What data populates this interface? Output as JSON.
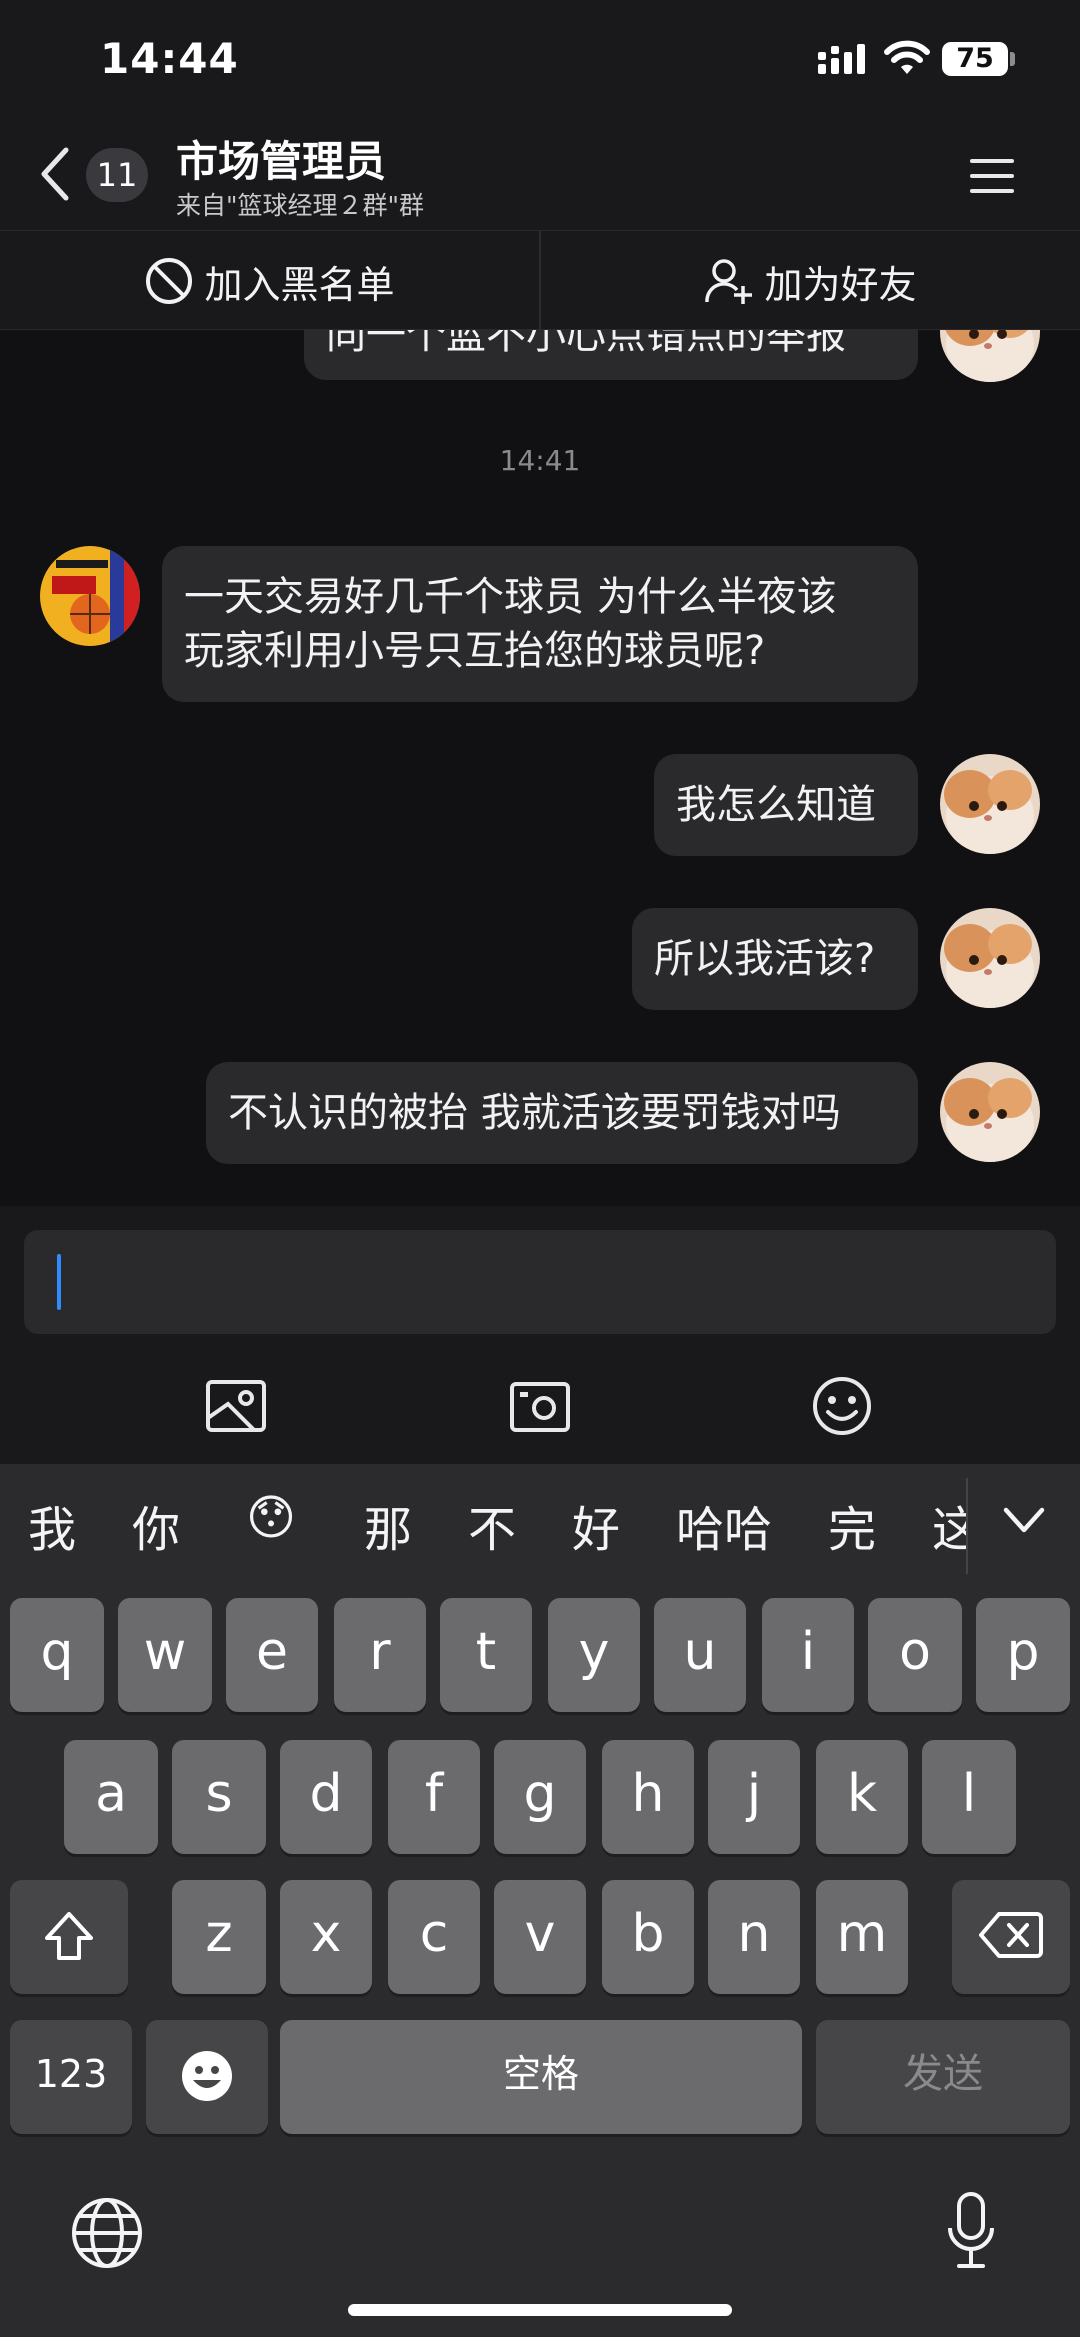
{
  "status_bar": {
    "time": "14:44",
    "battery": "75"
  },
  "header": {
    "unread_count": "11",
    "title": "市场管理员",
    "subtitle": "来自\"篮球经理２群\"群"
  },
  "actions": {
    "block_label": "加入黑名单",
    "add_friend_label": "加为好友"
  },
  "messages": {
    "partial_top": "同一个蓝不小心点错点的举报",
    "timestamp": "14:41",
    "incoming_1_line1": "一天交易好几千个球员 为什么半夜该",
    "incoming_1_line2": "玩家利用小号只互抬您的球员呢?",
    "outgoing_1": "我怎么知道",
    "outgoing_2": "所以我活该?",
    "outgoing_3": "不认识的被抬 我就活该要罚钱对吗"
  },
  "keyboard": {
    "suggestions": [
      "我",
      "你",
      "😯",
      "那",
      "不",
      "好",
      "哈哈",
      "完",
      "这"
    ],
    "row1": [
      "q",
      "w",
      "e",
      "r",
      "t",
      "y",
      "u",
      "i",
      "o",
      "p"
    ],
    "row2": [
      "a",
      "s",
      "d",
      "f",
      "g",
      "h",
      "j",
      "k",
      "l"
    ],
    "row3": [
      "z",
      "x",
      "c",
      "v",
      "b",
      "n",
      "m"
    ],
    "numbers_label": "123",
    "space_label": "空格",
    "send_label": "发送"
  },
  "icons": {
    "back": "chevron-left-icon",
    "menu": "hamburger-menu-icon",
    "block": "block-icon",
    "add_friend": "add-user-icon",
    "image": "image-icon",
    "camera": "camera-icon",
    "emoji": "emoji-icon",
    "shift": "shift-icon",
    "delete": "backspace-icon",
    "emoji_key": "emoji-key-icon",
    "globe": "globe-icon",
    "mic": "microphone-icon"
  },
  "colors": {
    "background": "#111113",
    "bubble": "#2a2a2d",
    "caret": "#2f8bff",
    "key": "#6b6b6e",
    "key_dark": "#464649"
  }
}
